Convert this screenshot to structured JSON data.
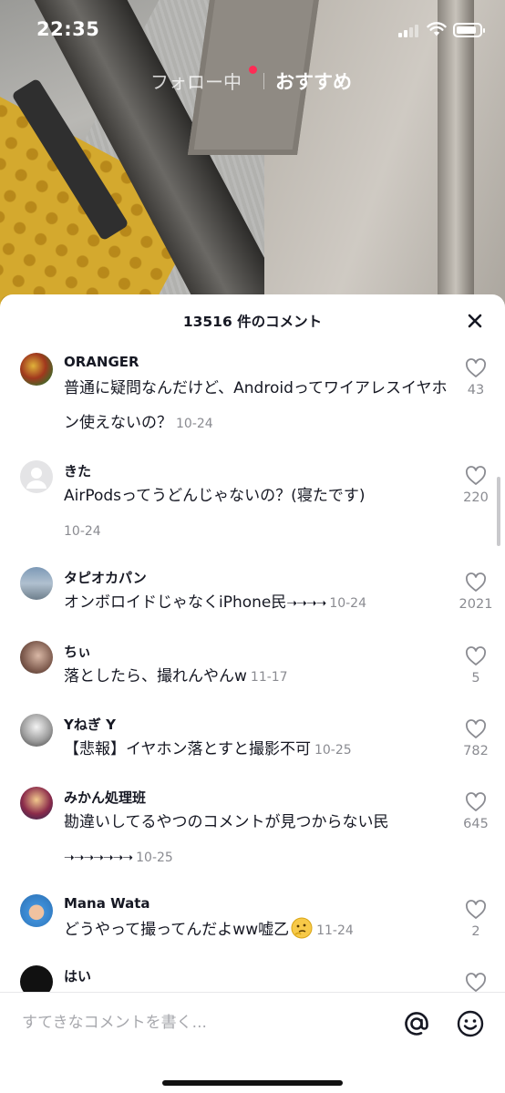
{
  "status_bar": {
    "time": "22:35"
  },
  "top_tabs": {
    "following": "フォロー中",
    "for_you": "おすすめ"
  },
  "comments_panel": {
    "title": "13516 件のコメント",
    "comments": [
      {
        "username": "ORANGER",
        "text": "普通に疑問なんだけど、Androidってワイアレスイヤホン使えないの？",
        "date": "10-24",
        "likes": "43"
      },
      {
        "username": "きた",
        "text": "AirPodsってうどんじゃないの？(寝たです)",
        "date": "10-24",
        "likes": "220"
      },
      {
        "username": "タピオカパン",
        "text": "オンボロイドじゃなくiPhone民",
        "arrows": "➝➝➝➝",
        "date": "10-24",
        "likes": "2021"
      },
      {
        "username": "ちぃ",
        "text": "落としたら、撮れんやんw",
        "date": "11-17",
        "likes": "5"
      },
      {
        "username": "Yねぎ Y",
        "text": "【悲報】イヤホン落とすと撮影不可",
        "date": "10-25",
        "likes": "782"
      },
      {
        "username": "みかん処理班",
        "text": "勘違いしてるやつのコメントが見つからない民",
        "arrows": "➝➝➝➝➝➝➝",
        "date": "10-25",
        "likes": "645"
      },
      {
        "username": "Mana Wata",
        "text": "どうやって撮ってんだよww嘘乙",
        "date": "11-24",
        "likes": "2"
      },
      {
        "username": "はい",
        "text": "",
        "date": "",
        "likes": ""
      }
    ]
  },
  "input_bar": {
    "placeholder": "すてきなコメントを書く..."
  },
  "colors": {
    "accent": "#fe2c55",
    "text": "#161823",
    "muted": "#8a8b91"
  }
}
